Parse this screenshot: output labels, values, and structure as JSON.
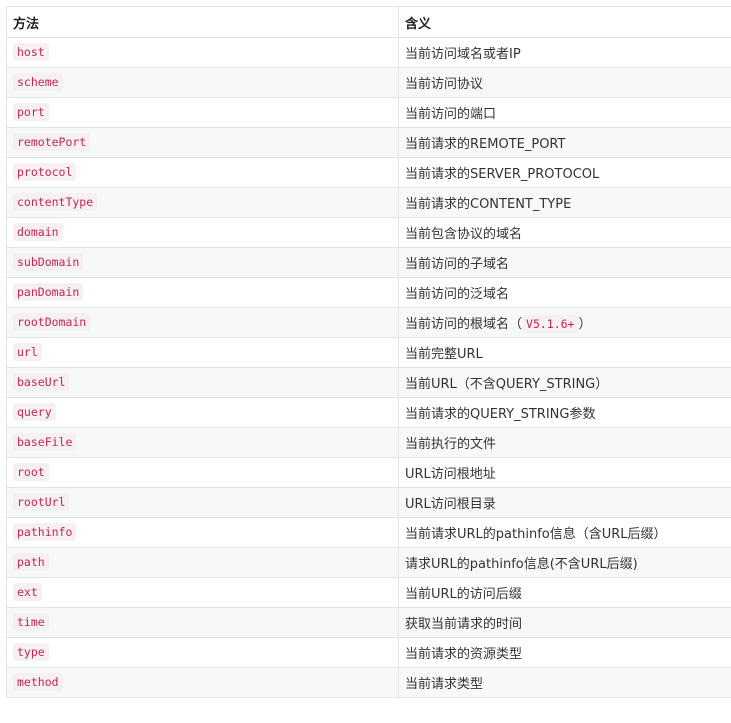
{
  "table": {
    "headers": {
      "method": "方法",
      "meaning": "含义"
    },
    "rows": [
      {
        "method": "host",
        "meaning": "当前访问域名或者IP"
      },
      {
        "method": "scheme",
        "meaning": "当前访问协议"
      },
      {
        "method": "port",
        "meaning": "当前访问的端口"
      },
      {
        "method": "remotePort",
        "meaning": "当前请求的REMOTE_PORT"
      },
      {
        "method": "protocol",
        "meaning": "当前请求的SERVER_PROTOCOL"
      },
      {
        "method": "contentType",
        "meaning": "当前请求的CONTENT_TYPE"
      },
      {
        "method": "domain",
        "meaning": "当前包含协议的域名"
      },
      {
        "method": "subDomain",
        "meaning": "当前访问的子域名"
      },
      {
        "method": "panDomain",
        "meaning": "当前访问的泛域名"
      },
      {
        "method": "rootDomain",
        "meaning": "当前访问的根域名（",
        "version": "V5.1.6+",
        "meaning_suffix": "）"
      },
      {
        "method": "url",
        "meaning": "当前完整URL"
      },
      {
        "method": "baseUrl",
        "meaning": "当前URL（不含QUERY_STRING）"
      },
      {
        "method": "query",
        "meaning": "当前请求的QUERY_STRING参数"
      },
      {
        "method": "baseFile",
        "meaning": "当前执行的文件"
      },
      {
        "method": "root",
        "meaning": "URL访问根地址"
      },
      {
        "method": "rootUrl",
        "meaning": "URL访问根目录"
      },
      {
        "method": "pathinfo",
        "meaning": "当前请求URL的pathinfo信息（含URL后缀）"
      },
      {
        "method": "path",
        "meaning": "请求URL的pathinfo信息(不含URL后缀)"
      },
      {
        "method": "ext",
        "meaning": "当前URL的访问后缀"
      },
      {
        "method": "time",
        "meaning": "获取当前请求的时间"
      },
      {
        "method": "type",
        "meaning": "当前请求的资源类型"
      },
      {
        "method": "method",
        "meaning": "当前请求类型"
      }
    ]
  }
}
